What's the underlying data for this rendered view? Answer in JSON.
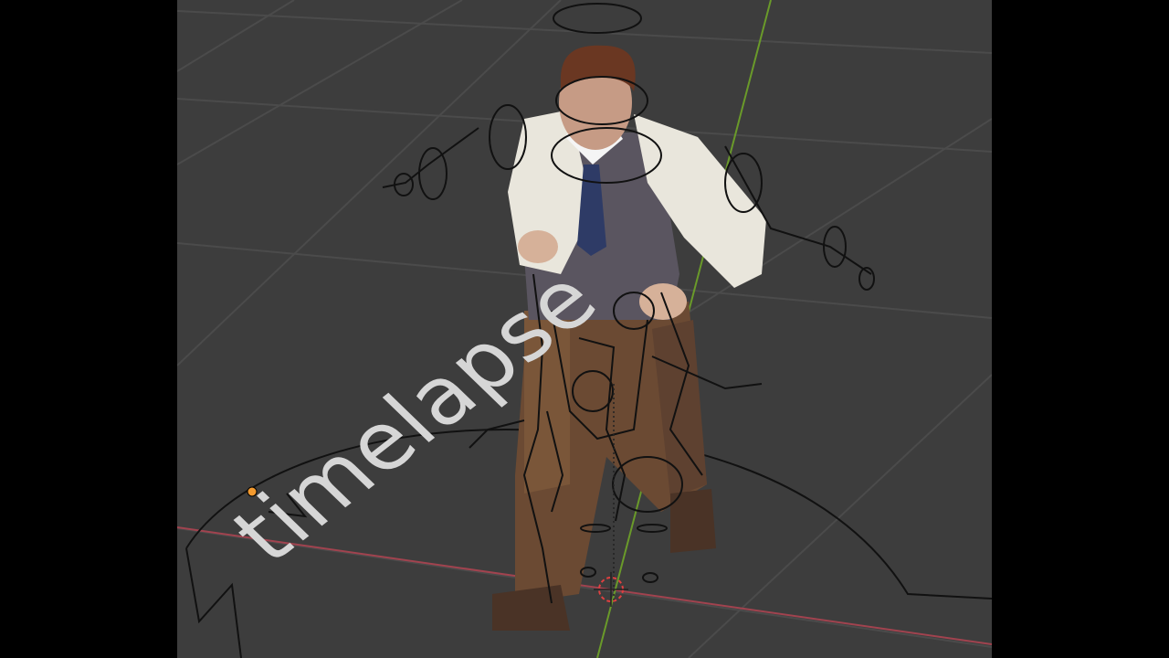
{
  "viewport": {
    "overlay_text": "timelapse",
    "colors": {
      "background": "#3d3d3d",
      "grid": "#4a4a4a",
      "x_axis": "#a1434f",
      "y_axis": "#6a9a2a",
      "armature": "#111111",
      "origin": "#f39a2f"
    },
    "character": {
      "name": "man-with-vest",
      "visible": true
    },
    "icons": [
      "object-origin-icon",
      "3d-cursor-icon"
    ]
  }
}
